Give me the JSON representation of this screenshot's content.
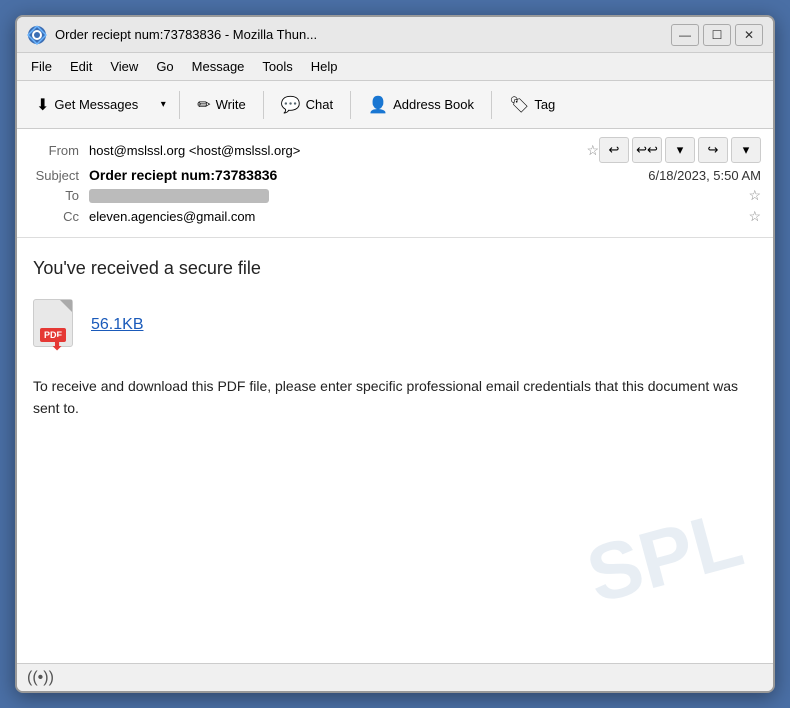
{
  "window": {
    "title": "Order reciept num:73783836 - Mozilla Thun...",
    "icon": "thunderbird"
  },
  "title_controls": {
    "minimize": "—",
    "maximize": "☐",
    "close": "✕"
  },
  "menu": {
    "items": [
      "File",
      "Edit",
      "View",
      "Go",
      "Message",
      "Tools",
      "Help"
    ]
  },
  "toolbar": {
    "get_messages": "Get Messages",
    "write": "Write",
    "chat": "Chat",
    "address_book": "Address Book",
    "tag": "Tag"
  },
  "email": {
    "from_label": "From",
    "from_value": "host@mslssl.org <host@mslssl.org>",
    "subject_label": "Subject",
    "subject_value": "Order reciept num:73783836",
    "date_value": "6/18/2023, 5:50 AM",
    "to_label": "To",
    "to_redacted": true,
    "cc_label": "Cc",
    "cc_value": "eleven.agencies@gmail.com"
  },
  "body": {
    "secure_text": "You've received a secure file",
    "attachment_size": "56.1KB",
    "body_text": "To receive and download this PDF file, please enter specific professional email credentials that this document was sent to."
  },
  "status_bar": {
    "icon": "((•))"
  }
}
